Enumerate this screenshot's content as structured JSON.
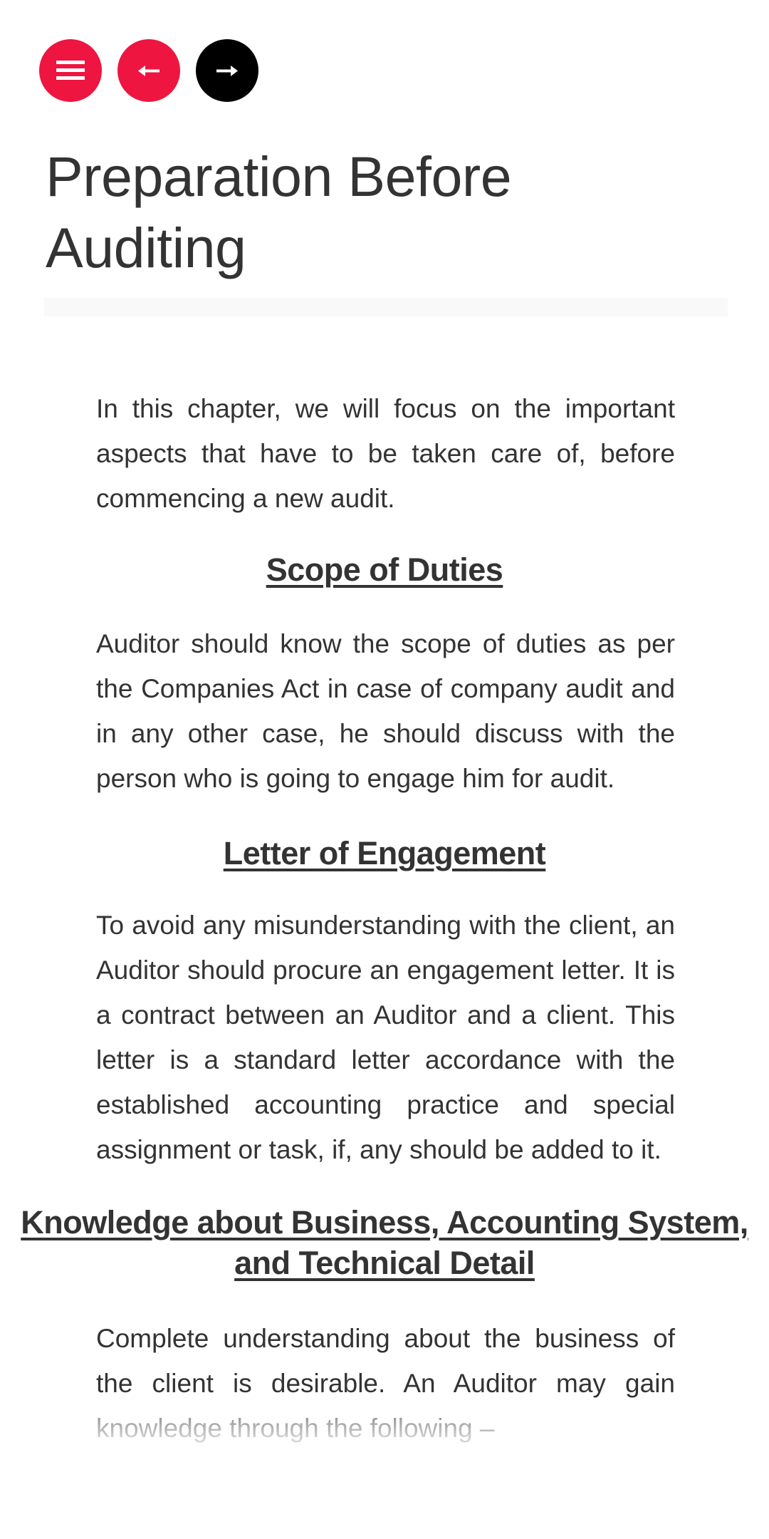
{
  "nav": {
    "menu_icon": "hamburger-menu-icon",
    "prev_icon": "arrow-left-icon",
    "next_icon": "arrow-right-icon",
    "accent_color": "#ee1540",
    "next_color": "#000000"
  },
  "page_title": "Preparation Before Auditing",
  "intro": "In this chapter, we will focus on the important aspects that have to be taken care of, before commencing a new audit.",
  "sections": [
    {
      "heading": "Scope of Duties",
      "body": "Auditor should know the scope of duties as per the Companies Act in case of company audit and in any other case, he should discuss with the person who is going to engage him for audit."
    },
    {
      "heading": "Letter of Engagement",
      "body": "To avoid any misunderstanding with the client, an Auditor should procure an engagement letter. It is a contract between an Auditor and a client. This letter is a standard letter accordance with the established accounting practice and special assignment or task, if, any should be added to it."
    },
    {
      "heading": "Knowledge about Business, Accounting System, and Technical Detail",
      "body": "Complete understanding about the business of the client is desirable. An Auditor may gain knowledge through the following –"
    }
  ]
}
